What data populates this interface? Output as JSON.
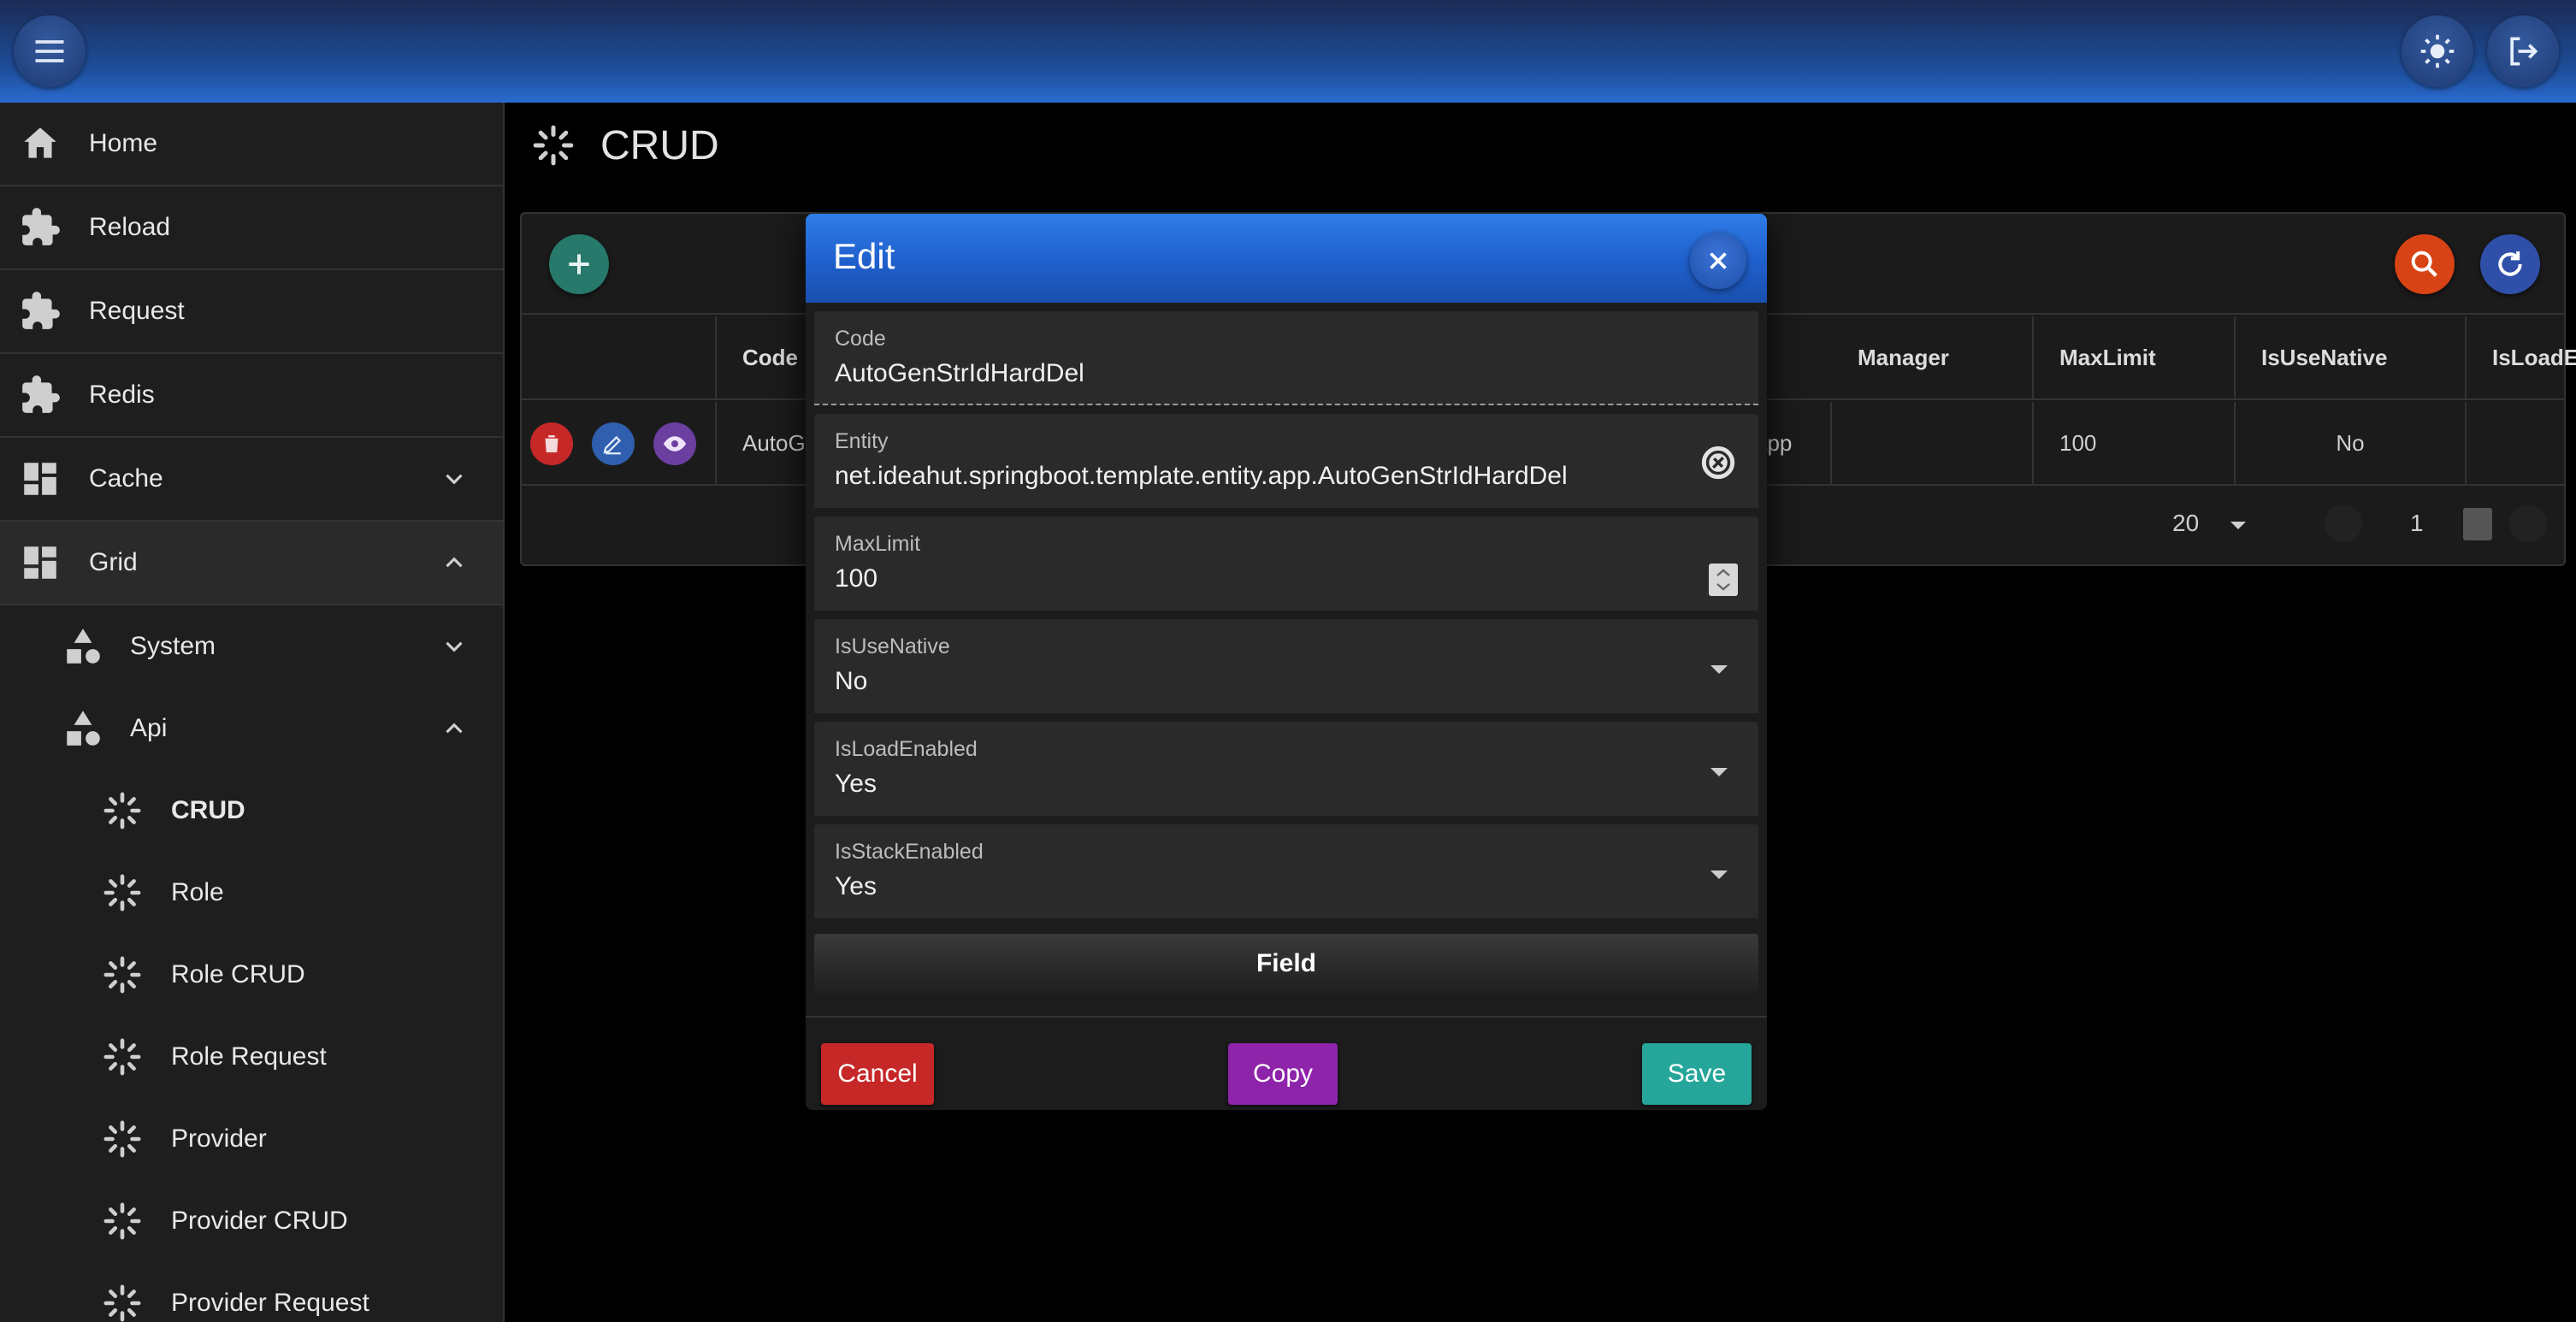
{
  "topbar": {
    "menu_icon": "menu-icon",
    "theme_icon": "sun-icon",
    "logout_icon": "logout-icon"
  },
  "sidebar": {
    "items": [
      {
        "label": "Home",
        "icon": "home-icon"
      },
      {
        "label": "Reload",
        "icon": "puzzle-icon"
      },
      {
        "label": "Request",
        "icon": "puzzle-icon"
      },
      {
        "label": "Redis",
        "icon": "puzzle-icon"
      },
      {
        "label": "Cache",
        "icon": "dashboard-icon",
        "expandable": true,
        "expanded": false
      },
      {
        "label": "Grid",
        "icon": "dashboard-icon",
        "expandable": true,
        "expanded": true
      }
    ],
    "grid_children": [
      {
        "label": "System",
        "icon": "shapes-icon",
        "expanded": false
      },
      {
        "label": "Api",
        "icon": "shapes-icon",
        "expanded": true
      }
    ],
    "api_children": [
      {
        "label": "CRUD",
        "icon": "spinner-icon",
        "active": true
      },
      {
        "label": "Role",
        "icon": "spinner-icon"
      },
      {
        "label": "Role CRUD",
        "icon": "spinner-icon"
      },
      {
        "label": "Role Request",
        "icon": "spinner-icon"
      },
      {
        "label": "Provider",
        "icon": "spinner-icon"
      },
      {
        "label": "Provider CRUD",
        "icon": "spinner-icon"
      },
      {
        "label": "Provider Request",
        "icon": "spinner-icon"
      }
    ]
  },
  "page": {
    "title": "CRUD",
    "title_icon": "spinner-icon"
  },
  "grid": {
    "columns": [
      "",
      "Code",
      "Manager",
      "MaxLimit",
      "IsUseNative",
      "IsLoadE"
    ],
    "row": {
      "code": "AutoG",
      "entity_suffix": "app",
      "manager": "",
      "maxlimit": "100",
      "isusenative": "No"
    },
    "page_size": "20",
    "page_number": "1"
  },
  "dialog": {
    "title": "Edit",
    "fields": [
      {
        "label": "Code",
        "value": "AutoGenStrIdHardDel"
      },
      {
        "label": "Entity",
        "value": "net.ideahut.springboot.template.entity.app.AutoGenStrIdHardDel"
      },
      {
        "label": "MaxLimit",
        "value": "100"
      },
      {
        "label": "IsUseNative",
        "value": "No"
      },
      {
        "label": "IsLoadEnabled",
        "value": "Yes"
      },
      {
        "label": "IsStackEnabled",
        "value": "Yes"
      }
    ],
    "field_button": "Field",
    "cancel": "Cancel",
    "copy": "Copy",
    "save": "Save"
  },
  "colors": {
    "cancel": "#c62828",
    "copy": "#8e24aa",
    "save": "#26a69a",
    "add": "#26796b",
    "search": "#d84315",
    "refresh": "#2f4fa8"
  }
}
